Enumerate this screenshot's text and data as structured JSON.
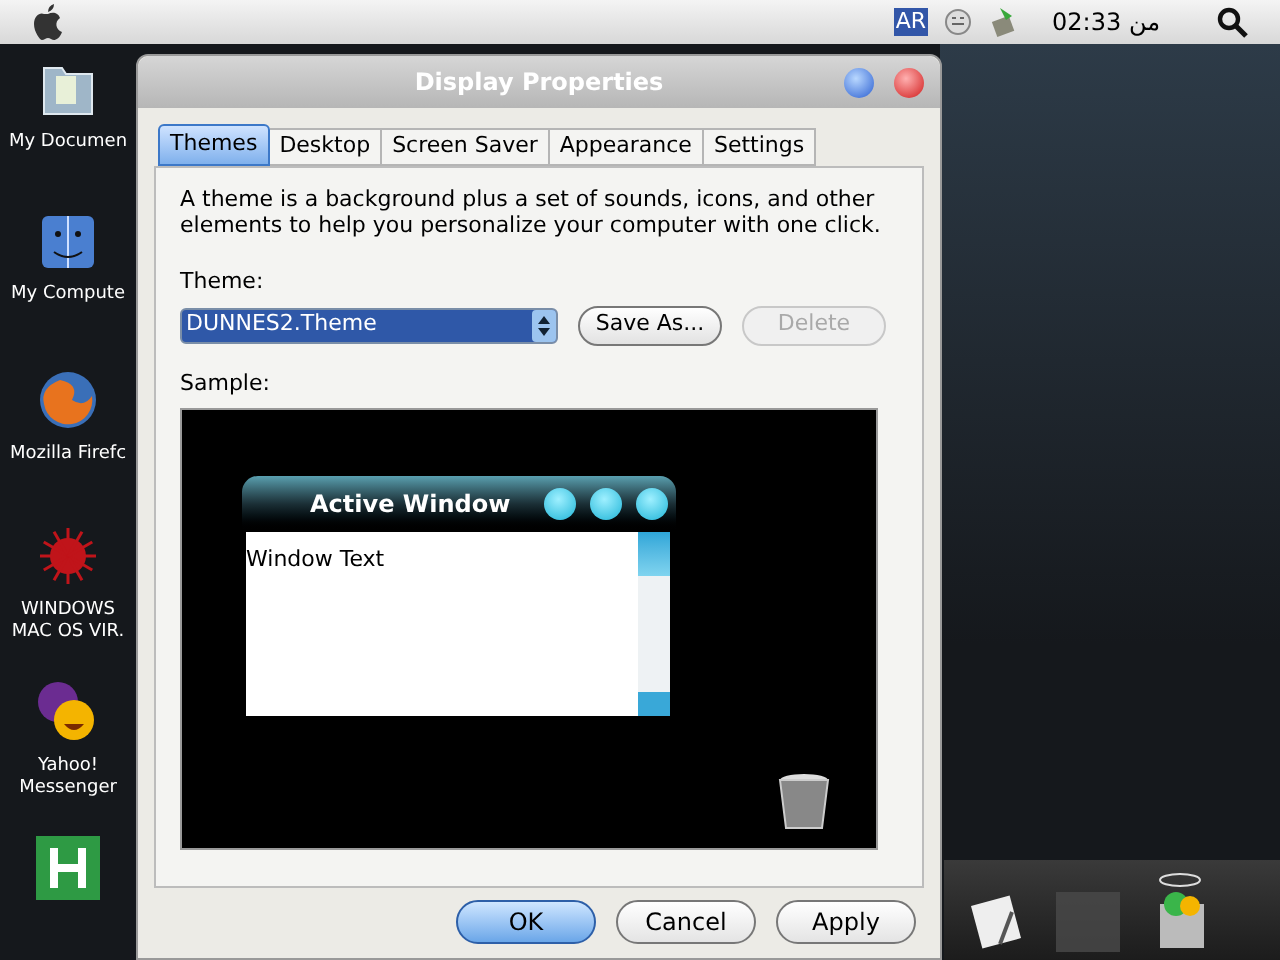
{
  "menubar": {
    "input_badge": "AR",
    "clock": "02:33 من"
  },
  "desktop_icons": [
    {
      "kind": "folder",
      "label": "My Documen"
    },
    {
      "kind": "finder",
      "label": "My Compute"
    },
    {
      "kind": "browser",
      "label": "Mozilla Firefc"
    },
    {
      "kind": "virus",
      "label": "WINDOWS MAC OS VIR."
    },
    {
      "kind": "messenger",
      "label": "Yahoo! Messenger"
    },
    {
      "kind": "letter"
    }
  ],
  "dialog": {
    "title": "Display Properties",
    "tabs": [
      {
        "label": "Themes",
        "selected": true
      },
      {
        "label": "Desktop",
        "selected": false
      },
      {
        "label": "Screen Saver",
        "selected": false
      },
      {
        "label": "Appearance",
        "selected": false
      },
      {
        "label": "Settings",
        "selected": false
      }
    ],
    "description": "A theme is a background plus a set of sounds, icons, and other elements to help you personalize your computer with one click.",
    "theme_label": "Theme:",
    "theme_value": "DUNNES2.Theme",
    "theme_buttons": [
      {
        "label": "Save As...",
        "disabled": false
      },
      {
        "label": "Delete",
        "disabled": true
      }
    ],
    "sample_label": "Sample:",
    "sample": {
      "window_title": "Active Window",
      "window_text": "Window Text"
    },
    "footer_buttons": [
      {
        "label": "OK",
        "default": true
      },
      {
        "label": "Cancel",
        "default": false
      },
      {
        "label": "Apply",
        "default": false
      }
    ]
  }
}
